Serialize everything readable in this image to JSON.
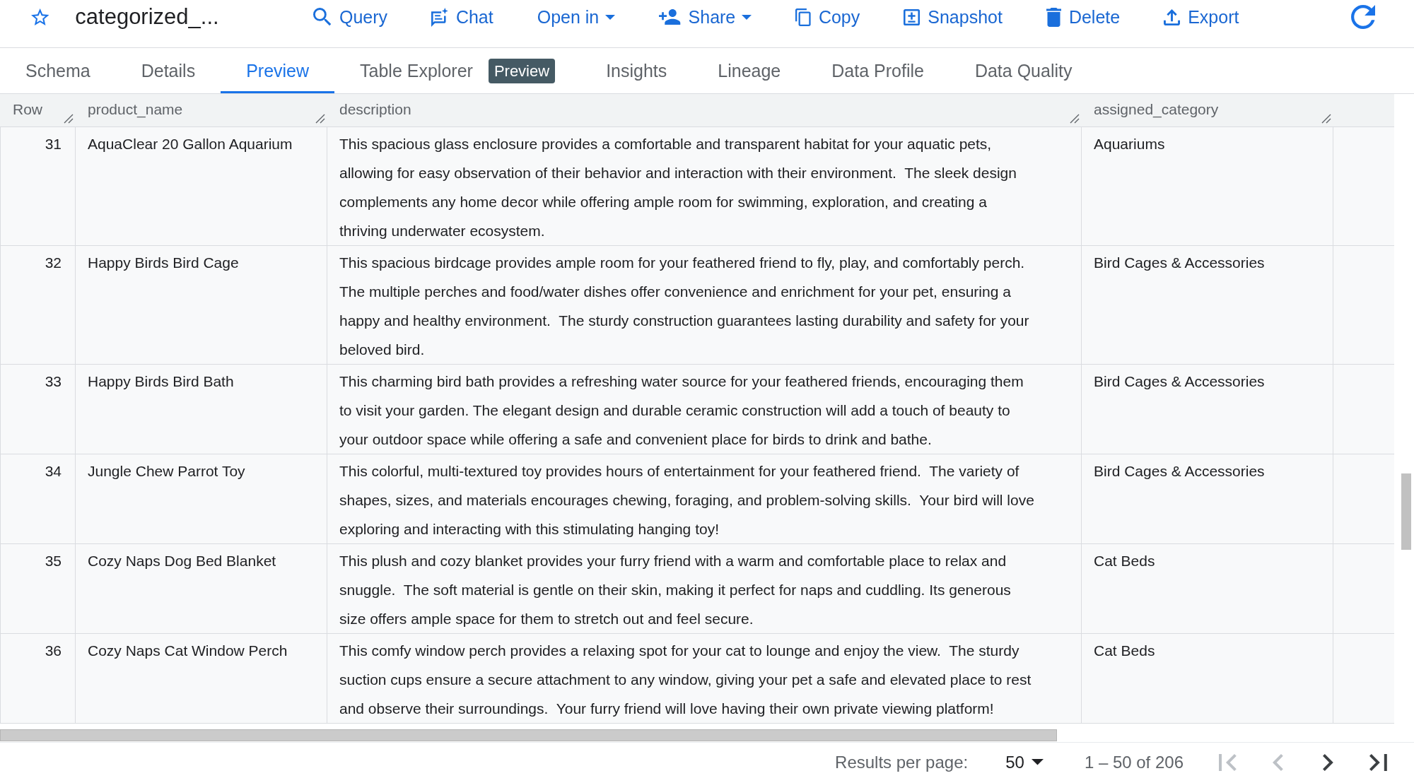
{
  "toolbar": {
    "title": "categorized_...",
    "starred": false,
    "actions": [
      {
        "kind": "query",
        "label": "Query",
        "has_menu": false
      },
      {
        "kind": "chat",
        "label": "Chat",
        "has_menu": false
      },
      {
        "kind": "open-in",
        "label": "Open in",
        "has_menu": true
      },
      {
        "kind": "share",
        "label": "Share",
        "has_menu": true
      },
      {
        "kind": "copy",
        "label": "Copy",
        "has_menu": false
      },
      {
        "kind": "snapshot",
        "label": "Snapshot",
        "has_menu": false
      },
      {
        "kind": "delete",
        "label": "Delete",
        "has_menu": false
      },
      {
        "kind": "export",
        "label": "Export",
        "has_menu": false
      }
    ]
  },
  "tabs": [
    {
      "label": "Schema",
      "selected": false
    },
    {
      "label": "Details",
      "selected": false
    },
    {
      "label": "Preview",
      "selected": true
    },
    {
      "label": "Table Explorer",
      "selected": false,
      "badge": "Preview"
    },
    {
      "label": "Insights",
      "selected": false
    },
    {
      "label": "Lineage",
      "selected": false
    },
    {
      "label": "Data Profile",
      "selected": false
    },
    {
      "label": "Data Quality",
      "selected": false
    }
  ],
  "table": {
    "columns": [
      "Row",
      "product_name",
      "description",
      "assigned_category"
    ],
    "rows": [
      {
        "row": "31",
        "product_name": "AquaClear 20 Gallon Aquarium",
        "description": "This spacious glass enclosure provides a comfortable and transparent habitat for your aquatic pets, allowing for easy observation of their behavior and interaction with their environment.  The sleek design complements any home decor while offering ample room for swimming, exploration, and creating a thriving underwater ecosystem.",
        "assigned_category": "Aquariums"
      },
      {
        "row": "32",
        "product_name": "Happy Birds Bird Cage",
        "description": "This spacious birdcage provides ample room for your feathered friend to fly, play, and comfortably perch. The multiple perches and food/water dishes offer convenience and enrichment for your pet, ensuring a happy and healthy environment.  The sturdy construction guarantees lasting durability and safety for your beloved bird.",
        "assigned_category": "Bird Cages & Accessories"
      },
      {
        "row": "33",
        "product_name": "Happy Birds Bird Bath",
        "description": "This charming bird bath provides a refreshing water source for your feathered friends, encouraging them to visit your garden. The elegant design and durable ceramic construction will add a touch of beauty to your outdoor space while offering a safe and convenient place for birds to drink and bathe.",
        "assigned_category": "Bird Cages & Accessories"
      },
      {
        "row": "34",
        "product_name": "Jungle Chew Parrot Toy",
        "description": "This colorful, multi-textured toy provides hours of entertainment for your feathered friend.  The variety of shapes, sizes, and materials encourages chewing, foraging, and problem-solving skills.  Your bird will love exploring and interacting with this stimulating hanging toy!",
        "assigned_category": "Bird Cages & Accessories"
      },
      {
        "row": "35",
        "product_name": "Cozy Naps Dog Bed Blanket",
        "description": "This plush and cozy blanket provides your furry friend with a warm and comfortable place to relax and snuggle.  The soft material is gentle on their skin, making it perfect for naps and cuddling. Its generous size offers ample space for them to stretch out and feel secure.",
        "assigned_category": "Cat Beds"
      },
      {
        "row": "36",
        "product_name": "Cozy Naps Cat Window Perch",
        "description": "This comfy window perch provides a relaxing spot for your cat to lounge and enjoy the view.  The sturdy suction cups ensure a secure attachment to any window, giving your pet a safe and elevated place to rest and observe their surroundings.  Your furry friend will love having their own private viewing platform!",
        "assigned_category": "Cat Beds"
      }
    ]
  },
  "pagination": {
    "label": "Results per page:",
    "page_size": "50",
    "range": "1 – 50 of 206",
    "buttons": [
      {
        "kind": "first",
        "disabled": true
      },
      {
        "kind": "previous",
        "disabled": true
      },
      {
        "kind": "next",
        "disabled": false
      },
      {
        "kind": "last",
        "disabled": false
      }
    ]
  }
}
